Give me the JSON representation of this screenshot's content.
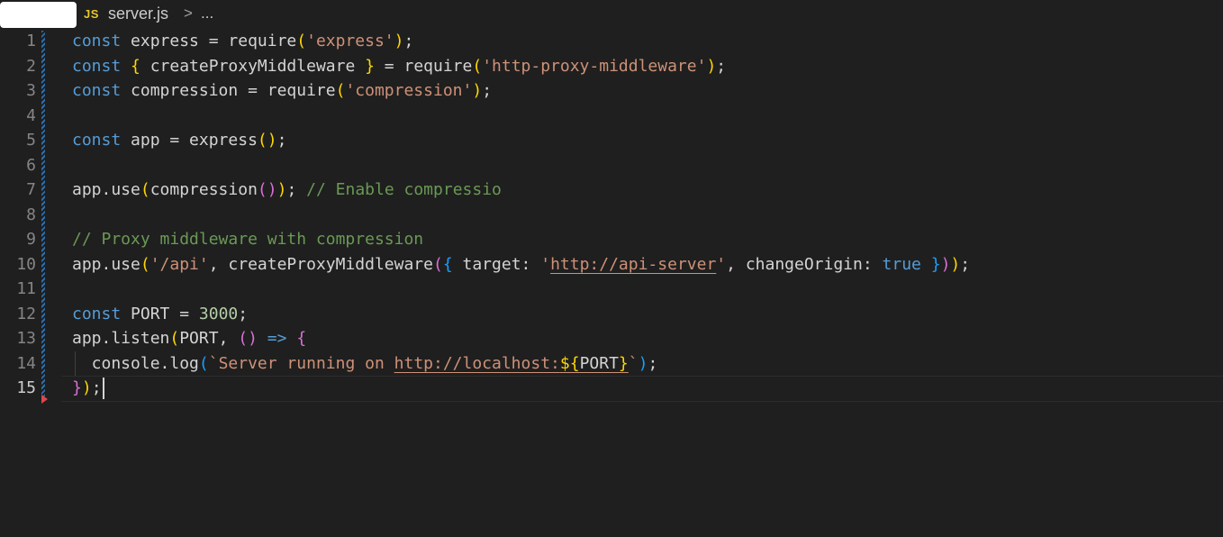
{
  "breadcrumb": {
    "file_icon": "JS",
    "file_name": "server.js",
    "separator": ">",
    "more": "..."
  },
  "editor": {
    "active_line": 15,
    "line_numbers": [
      "1",
      "2",
      "3",
      "4",
      "5",
      "6",
      "7",
      "8",
      "9",
      "10",
      "11",
      "12",
      "13",
      "14",
      "15"
    ],
    "colors": {
      "keyword": "#569cd6",
      "string": "#ce9178",
      "comment": "#6a9955",
      "number": "#b5cea8",
      "bracket_gold": "#ffd700",
      "bracket_orchid": "#da70d6",
      "bracket_blue": "#179fff",
      "text": "#d4d4d4",
      "background": "#1f1f1f"
    },
    "lines": [
      {
        "tokens": [
          {
            "t": "const",
            "k": "kw"
          },
          {
            "t": " express = require"
          },
          {
            "t": "(",
            "k": "b1"
          },
          {
            "t": "'express'",
            "k": "str"
          },
          {
            "t": ")",
            "k": "b1"
          },
          {
            "t": ";"
          }
        ]
      },
      {
        "tokens": [
          {
            "t": "const",
            "k": "kw"
          },
          {
            "t": " "
          },
          {
            "t": "{",
            "k": "b1"
          },
          {
            "t": " createProxyMiddleware "
          },
          {
            "t": "}",
            "k": "b1"
          },
          {
            "t": " = require"
          },
          {
            "t": "(",
            "k": "b1"
          },
          {
            "t": "'http-proxy-middleware'",
            "k": "str"
          },
          {
            "t": ")",
            "k": "b1"
          },
          {
            "t": ";"
          }
        ]
      },
      {
        "tokens": [
          {
            "t": "const",
            "k": "kw"
          },
          {
            "t": " compression = require"
          },
          {
            "t": "(",
            "k": "b1"
          },
          {
            "t": "'compression'",
            "k": "str"
          },
          {
            "t": ")",
            "k": "b1"
          },
          {
            "t": ";"
          }
        ]
      },
      {
        "tokens": []
      },
      {
        "tokens": [
          {
            "t": "const",
            "k": "kw"
          },
          {
            "t": " app = express"
          },
          {
            "t": "()",
            "k": "b1"
          },
          {
            "t": ";"
          }
        ]
      },
      {
        "tokens": []
      },
      {
        "tokens": [
          {
            "t": "app.use"
          },
          {
            "t": "(",
            "k": "b1"
          },
          {
            "t": "compression"
          },
          {
            "t": "()",
            "k": "b2"
          },
          {
            "t": ")",
            "k": "b1"
          },
          {
            "t": "; "
          },
          {
            "t": "// Enable compressio",
            "k": "cm"
          }
        ]
      },
      {
        "tokens": []
      },
      {
        "tokens": [
          {
            "t": "// Proxy middleware with compression",
            "k": "cm"
          }
        ]
      },
      {
        "tokens": [
          {
            "t": "app.use"
          },
          {
            "t": "(",
            "k": "b1"
          },
          {
            "t": "'/api'",
            "k": "str"
          },
          {
            "t": ", createProxyMiddleware"
          },
          {
            "t": "(",
            "k": "b2"
          },
          {
            "t": "{",
            "k": "b3"
          },
          {
            "t": " target: "
          },
          {
            "t": "'",
            "k": "str"
          },
          {
            "t": "http://api-server",
            "k": "str ul"
          },
          {
            "t": "'",
            "k": "str"
          },
          {
            "t": ", changeOrigin: "
          },
          {
            "t": "true",
            "k": "kw"
          },
          {
            "t": " "
          },
          {
            "t": "}",
            "k": "b3"
          },
          {
            "t": ")",
            "k": "b2"
          },
          {
            "t": ")",
            "k": "b1"
          },
          {
            "t": ";"
          }
        ]
      },
      {
        "tokens": []
      },
      {
        "tokens": [
          {
            "t": "const",
            "k": "kw"
          },
          {
            "t": " PORT = "
          },
          {
            "t": "3000",
            "k": "num"
          },
          {
            "t": ";"
          }
        ]
      },
      {
        "tokens": [
          {
            "t": "app.listen"
          },
          {
            "t": "(",
            "k": "b1"
          },
          {
            "t": "PORT, "
          },
          {
            "t": "()",
            "k": "b2"
          },
          {
            "t": " "
          },
          {
            "t": "=>",
            "k": "kw"
          },
          {
            "t": " "
          },
          {
            "t": "{",
            "k": "b2"
          }
        ]
      },
      {
        "indent": true,
        "tokens": [
          {
            "t": "  console.log"
          },
          {
            "t": "(",
            "k": "b3"
          },
          {
            "t": "`Server running on ",
            "k": "str"
          },
          {
            "t": "http://localhost:",
            "k": "str ul"
          },
          {
            "t": "${",
            "k": "b1 ul"
          },
          {
            "t": "PORT",
            "k": "ul"
          },
          {
            "t": "}",
            "k": "b1 ul"
          },
          {
            "t": "`",
            "k": "str"
          },
          {
            "t": ")",
            "k": "b3"
          },
          {
            "t": ";"
          }
        ]
      },
      {
        "cursor": true,
        "tokens": [
          {
            "t": "}",
            "k": "b2"
          },
          {
            "t": ")",
            "k": "b1"
          },
          {
            "t": ";"
          }
        ]
      }
    ]
  }
}
